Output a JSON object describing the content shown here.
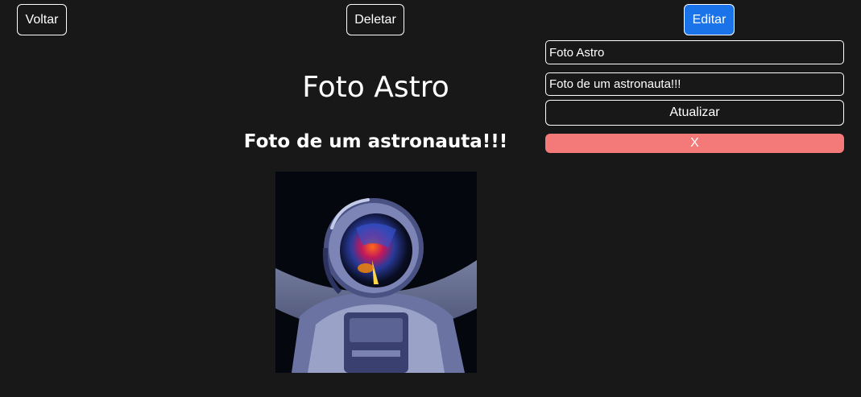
{
  "nav": {
    "back_label": "Voltar",
    "delete_label": "Deletar",
    "edit_label": "Editar"
  },
  "post": {
    "title": "Foto Astro",
    "description": "Foto de um astronauta!!!"
  },
  "edit_form": {
    "title_value": "Foto Astro",
    "description_value": "Foto de um astronauta!!!",
    "update_label": "Atualizar",
    "close_label": "X"
  },
  "colors": {
    "background": "#181818",
    "edit_button": "#1a73e8",
    "close_button": "#f47a7a"
  }
}
